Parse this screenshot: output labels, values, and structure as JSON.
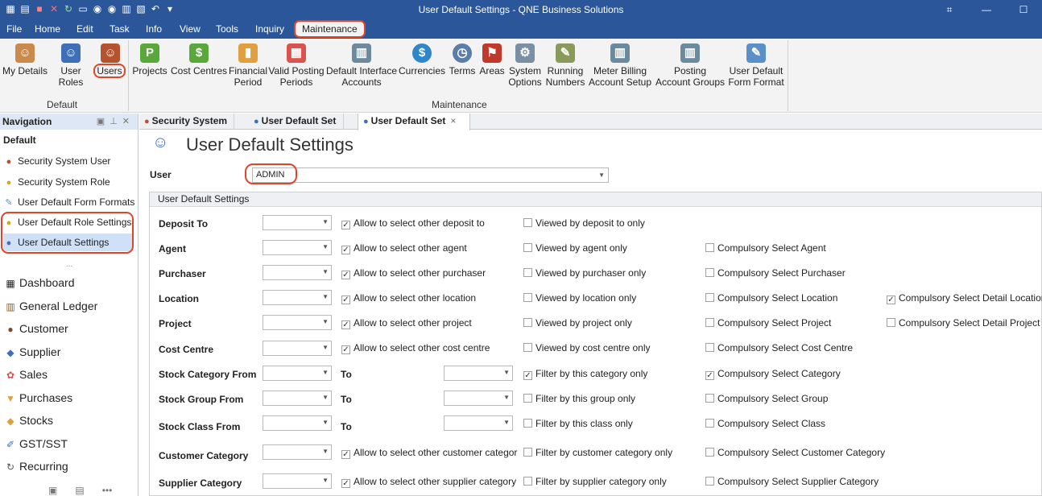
{
  "window": {
    "title": "User Default Settings - QNE Business Solutions",
    "qat_icons": [
      "app-menu-icon",
      "save-icon",
      "delete-icon",
      "close-icon",
      "refresh-icon",
      "new-icon",
      "circle-icon",
      "circle-icon",
      "grid-icon",
      "layout-icon",
      "undo-icon",
      "dropdown-icon"
    ],
    "win_buttons": [
      "fullscreen",
      "minimize",
      "maximize"
    ]
  },
  "menubar": {
    "items": [
      "File",
      "Home",
      "Edit",
      "Task",
      "Info",
      "View",
      "Tools",
      "Inquiry",
      "Maintenance"
    ]
  },
  "ribbon": {
    "default_group_label": "Default",
    "maintenance_group_label": "Maintenance",
    "buttons": [
      {
        "label1": "My Details",
        "label2": ""
      },
      {
        "label1": "User Roles",
        "label2": ""
      },
      {
        "label1": "Users",
        "label2": ""
      },
      {
        "label1": "Projects",
        "label2": ""
      },
      {
        "label1": "Cost Centres",
        "label2": ""
      },
      {
        "label1": "Financial",
        "label2": "Period"
      },
      {
        "label1": "Valid Posting",
        "label2": "Periods"
      },
      {
        "label1": "Default Interface",
        "label2": "Accounts"
      },
      {
        "label1": "Currencies",
        "label2": ""
      },
      {
        "label1": "Terms",
        "label2": ""
      },
      {
        "label1": "Areas",
        "label2": ""
      },
      {
        "label1": "System",
        "label2": "Options"
      },
      {
        "label1": "Running",
        "label2": "Numbers"
      },
      {
        "label1": "Meter Billing",
        "label2": "Account Setup"
      },
      {
        "label1": "Posting",
        "label2": "Account Groups"
      },
      {
        "label1": "User Default",
        "label2": "Form Format"
      }
    ]
  },
  "navigation": {
    "header": "Navigation",
    "section": "Default",
    "items": [
      "Security System User",
      "Security System Role",
      "User Default Form Formats",
      "User Default Role Settings",
      "User Default Settings"
    ],
    "dots": "...",
    "modules": [
      "Dashboard",
      "General Ledger",
      "Customer",
      "Supplier",
      "Sales",
      "Purchases",
      "Stocks",
      "GST/SST",
      "Recurring"
    ],
    "footer": [
      "▣",
      "▤",
      "•••"
    ]
  },
  "tabs": [
    {
      "label": "Security System"
    },
    {
      "label": "User Default Set"
    },
    {
      "label": "User Default Set",
      "close": "×"
    }
  ],
  "form": {
    "title": "User Default Settings",
    "user_label": "User",
    "user_value": "ADMIN",
    "group_title": "User Default Settings",
    "to_label": "To",
    "rows": [
      {
        "label": "Deposit To",
        "c1": "Allow to select other deposit to",
        "c1_checked": true,
        "c2": "Viewed by deposit to only",
        "c2_checked": false,
        "c3": "",
        "c3_checked": false,
        "c4": "",
        "c4_checked": false
      },
      {
        "label": "Agent",
        "c1": "Allow to select other agent",
        "c1_checked": true,
        "c2": "Viewed by agent only",
        "c2_checked": false,
        "c3": "Compulsory Select Agent",
        "c3_checked": false,
        "c4": "",
        "c4_checked": false
      },
      {
        "label": "Purchaser",
        "c1": "Allow to select other purchaser",
        "c1_checked": true,
        "c2": "Viewed by purchaser only",
        "c2_checked": false,
        "c3": "Compulsory Select Purchaser",
        "c3_checked": false,
        "c4": "",
        "c4_checked": false
      },
      {
        "label": "Location",
        "c1": "Allow to select other location",
        "c1_checked": true,
        "c2": "Viewed by location only",
        "c2_checked": false,
        "c3": "Compulsory Select Location",
        "c3_checked": false,
        "c4": "Compulsory Select Detail Location",
        "c4_checked": true
      },
      {
        "label": "Project",
        "c1": "Allow to select other project",
        "c1_checked": true,
        "c2": "Viewed by project only",
        "c2_checked": false,
        "c3": "Compulsory Select Project",
        "c3_checked": false,
        "c4": "Compulsory Select Detail Project",
        "c4_checked": false
      },
      {
        "label": "Cost Centre",
        "c1": "Allow to select other cost centre",
        "c1_checked": true,
        "c2": "Viewed by cost centre only",
        "c2_checked": false,
        "c3": "Compulsory Select Cost Centre",
        "c3_checked": false,
        "c4": "",
        "c4_checked": false
      },
      {
        "label": "Stock Category From",
        "has_to": true,
        "c2": "Filter by this category only",
        "c2_checked": true,
        "c3": "Compulsory Select Category",
        "c3_checked": true
      },
      {
        "label": "Stock Group From",
        "has_to": true,
        "c2": "Filter by this group only",
        "c2_checked": false,
        "c3": "Compulsory Select Group",
        "c3_checked": false
      },
      {
        "label": "Stock Class From",
        "has_to": true,
        "c2": "Filter by this class only",
        "c2_checked": false,
        "c3": "Compulsory Select Class",
        "c3_checked": false
      },
      {
        "label": "Customer Category",
        "c1": "Allow to select other customer categor",
        "c1_checked": true,
        "c2": "Filter by customer category only",
        "c2_checked": false,
        "c3": "Compulsory Select Customer Category",
        "c3_checked": false,
        "c4": "",
        "c4_checked": false
      },
      {
        "label": "Supplier Category",
        "c1": "Allow to select other supplier category",
        "c1_checked": true,
        "c2": "Filter by supplier category only",
        "c2_checked": false,
        "c3": "Compulsory Select Supplier Category",
        "c3_checked": false,
        "c4": "",
        "c4_checked": false
      }
    ]
  },
  "colors": {
    "titlebar": "#2b579a",
    "highlight": "#e0452a",
    "ribbon_bg": "#f3f3f3",
    "nav_selected": "#cfe0f7"
  }
}
